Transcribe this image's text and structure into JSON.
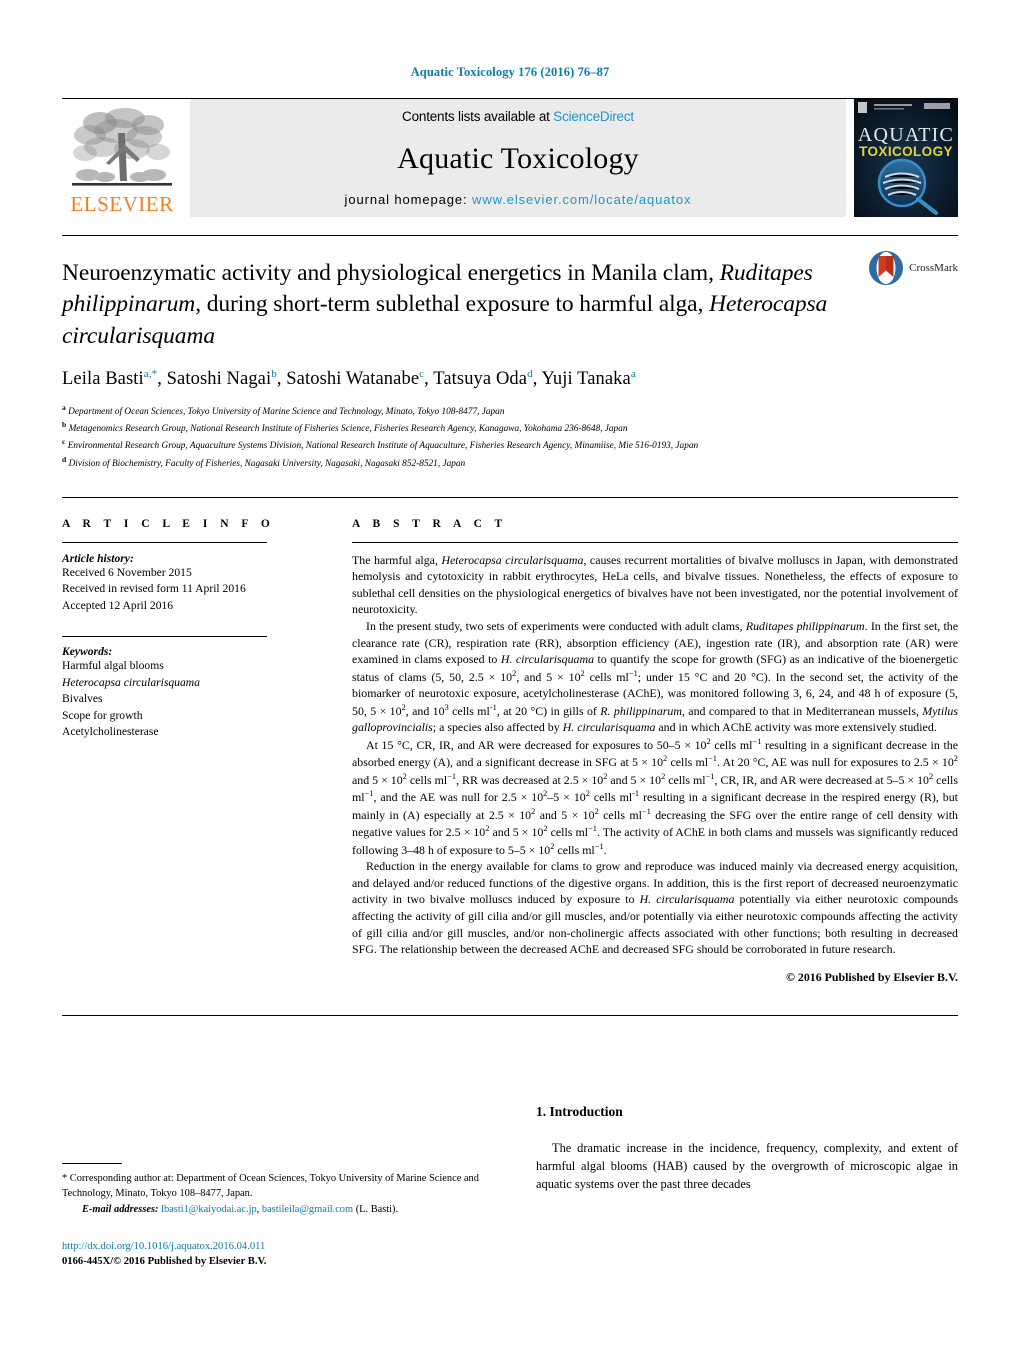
{
  "running_head": "Aquatic Toxicology 176 (2016) 76–87",
  "masthead": {
    "publisher_name": "ELSEVIER",
    "contents_prefix": "Contents lists available at ",
    "contents_link": "ScienceDirect",
    "journal_title": "Aquatic Toxicology",
    "homepage_prefix": "journal homepage: ",
    "homepage_url": "www.elsevier.com/locate/aquatox",
    "cover_title_line1": "AQUATIC",
    "cover_title_line2": "TOXICOLOGY"
  },
  "article": {
    "title_part1": "Neuroenzymatic activity and physiological energetics in Manila clam, ",
    "title_italic1": "Ruditapes philippinarum",
    "title_part2": ", during short-term sublethal exposure to harmful alga, ",
    "title_italic2": "Heterocapsa circularisquama",
    "crossmark_label": "CrossMark",
    "authors": [
      {
        "name": "Leila Basti",
        "sup": "a,*"
      },
      {
        "name": "Satoshi Nagai",
        "sup": "b"
      },
      {
        "name": "Satoshi Watanabe",
        "sup": "c"
      },
      {
        "name": "Tatsuya Oda",
        "sup": "d"
      },
      {
        "name": "Yuji Tanaka",
        "sup": "a"
      }
    ],
    "affiliations": [
      {
        "marker": "a",
        "text": "Department of Ocean Sciences, Tokyo University of Marine Science and Technology, Minato, Tokyo 108-8477, Japan"
      },
      {
        "marker": "b",
        "text": "Metagenomics Research Group, National Research Institute of Fisheries Science, Fisheries Research Agency, Kanagawa, Yokohama 236-8648, Japan"
      },
      {
        "marker": "c",
        "text": "Environmental Research Group, Aquaculture Systems Division, National Research Institute of Aquaculture, Fisheries Research Agency, Minamiise, Mie 516-0193, Japan"
      },
      {
        "marker": "d",
        "text": "Division of Biochemistry, Faculty of Fisheries, Nagasaki University, Nagasaki, Nagasaki 852-8521, Japan"
      }
    ]
  },
  "article_info": {
    "heading": "A R T I C L E   I N F O",
    "history_label": "Article history:",
    "history": [
      "Received 6 November 2015",
      "Received in revised form 11 April 2016",
      "Accepted 12 April 2016"
    ],
    "keywords_label": "Keywords:",
    "keywords": [
      "Harmful algal blooms",
      "Heterocapsa circularisquama",
      "Bivalves",
      "Scope for growth",
      "Acetylcholinesterase"
    ],
    "keyword_italic_index": 1
  },
  "abstract": {
    "heading": "A B S T R A C T",
    "paragraphs": [
      "The harmful alga, <i>Heterocapsa circularisquama</i>, causes recurrent mortalities of bivalve molluscs in Japan, with demonstrated hemolysis and cytotoxicity in rabbit erythrocytes, HeLa cells, and bivalve tissues. Nonetheless, the effects of exposure to sublethal cell densities on the physiological energetics of bivalves have not been investigated, nor the potential involvement of neurotoxicity.",
      "In the present study, two sets of experiments were conducted with adult clams, <i>Ruditapes philippinarum</i>. In the first set, the clearance rate (CR), respiration rate (RR), absorption efficiency (AE), ingestion rate (IR), and absorption rate (AR) were examined in clams exposed to <i>H. circularisquama</i> to quantify the scope for growth (SFG) as an indicative of the bioenergetic status of clams (5, 50, 2.5 &#215; 10<sup>2</sup>, and 5 &#215; 10<sup>2</sup> cells ml<sup>&#8722;1</sup>; under 15 &#176;C and 20 &#176;C). In the second set, the activity of the biomarker of neurotoxic exposure, acetylcholinesterase (AChE), was monitored following 3, 6, 24, and 48 h of exposure (5, 50, 5 &#215; 10<sup>2</sup>, and 10<sup>3</sup> cells ml<sup>-1</sup>, at 20 &#176;C) in gills of <i>R. philippinarum</i>, and compared to that in Mediterranean mussels, <i>Mytilus galloprovincialis</i>; a species also affected by <i>H. circularisquama</i> and in which AChE activity was more extensively studied.",
      "At 15 &#176;C, CR, IR, and AR were decreased for exposures to 50–5 &#215; 10<sup>2</sup> cells ml<sup>&#8722;1</sup> resulting in a significant decrease in the absorbed energy (A), and a significant decrease in SFG at 5 &#215; 10<sup>2</sup> cells ml<sup>&#8722;1</sup>. At 20 &#176;C, AE was null for exposures to 2.5 &#215; 10<sup>2</sup> and 5 &#215; 10<sup>2</sup> cells ml<sup>&#8722;1</sup>, RR was decreased at 2.5 &#215; 10<sup>2</sup> and 5 &#215; 10<sup>2</sup> cells ml<sup>&#8722;1</sup>, CR, IR, and AR were decreased at 5–5 &#215; 10<sup>2</sup> cells ml<sup>&#8722;1</sup>, and the AE was null for 2.5 &#215; 10<sup>2</sup>–5 &#215; 10<sup>2</sup> cells ml<sup>-1</sup> resulting in a significant decrease in the respired energy (R), but mainly in (A) especially at 2.5 &#215; 10<sup>2</sup> and 5 &#215; 10<sup>2</sup> cells ml<sup>&#8722;1</sup> decreasing the SFG over the entire range of cell density with negative values for 2.5 &#215; 10<sup>2</sup> and 5 &#215; 10<sup>2</sup> cells ml<sup>&#8722;1</sup>. The activity of AChE in both clams and mussels was significantly reduced following 3–48 h of exposure to 5–5 &#215; 10<sup>2</sup> cells ml<sup>&#8722;1</sup>.",
      "Reduction in the energy available for clams to grow and reproduce was induced mainly via decreased energy acquisition, and delayed and/or reduced functions of the digestive organs. In addition, this is the first report of decreased neuroenzymatic activity in two bivalve molluscs induced by exposure to <i>H. circularisquama</i> potentially via either neurotoxic compounds affecting the activity of gill cilia and/or gill muscles, and/or potentially via either neurotoxic compounds affecting the activity of gill cilia and/or gill muscles, and/or non-cholinergic affects associated with other functions; both resulting in decreased SFG. The relationship between the decreased AChE and decreased SFG should be corroborated in future research."
    ],
    "copyright": "© 2016 Published by Elsevier B.V."
  },
  "intro": {
    "heading": "1.  Introduction",
    "paragraph": "The dramatic increase in the incidence, frequency, complexity, and extent of harmful algal blooms (HAB) caused by the overgrowth of microscopic algae in aquatic systems over the past three decades"
  },
  "footer": {
    "corresponding_marker": "*",
    "corresponding_text": " Corresponding author at: Department of Ocean Sciences, Tokyo University of Marine Science and Technology, Minato, Tokyo 108–8477, Japan.",
    "email_label": "E-mail addresses:",
    "email_1": "lbasti1@kaiyodai.ac.jp",
    "email_sep": ", ",
    "email_2": "bastileila@gmail.com",
    "email_suffix": " (L. Basti).",
    "doi": "http://dx.doi.org/10.1016/j.aquatox.2016.04.011",
    "issn_line": "0166-445X/© 2016 Published by Elsevier B.V."
  },
  "colors": {
    "link_blue": "#0b7ca8",
    "science_direct_blue": "#2196c4",
    "elsevier_orange": "#f57f20",
    "masthead_gray": "#ebebeb"
  }
}
